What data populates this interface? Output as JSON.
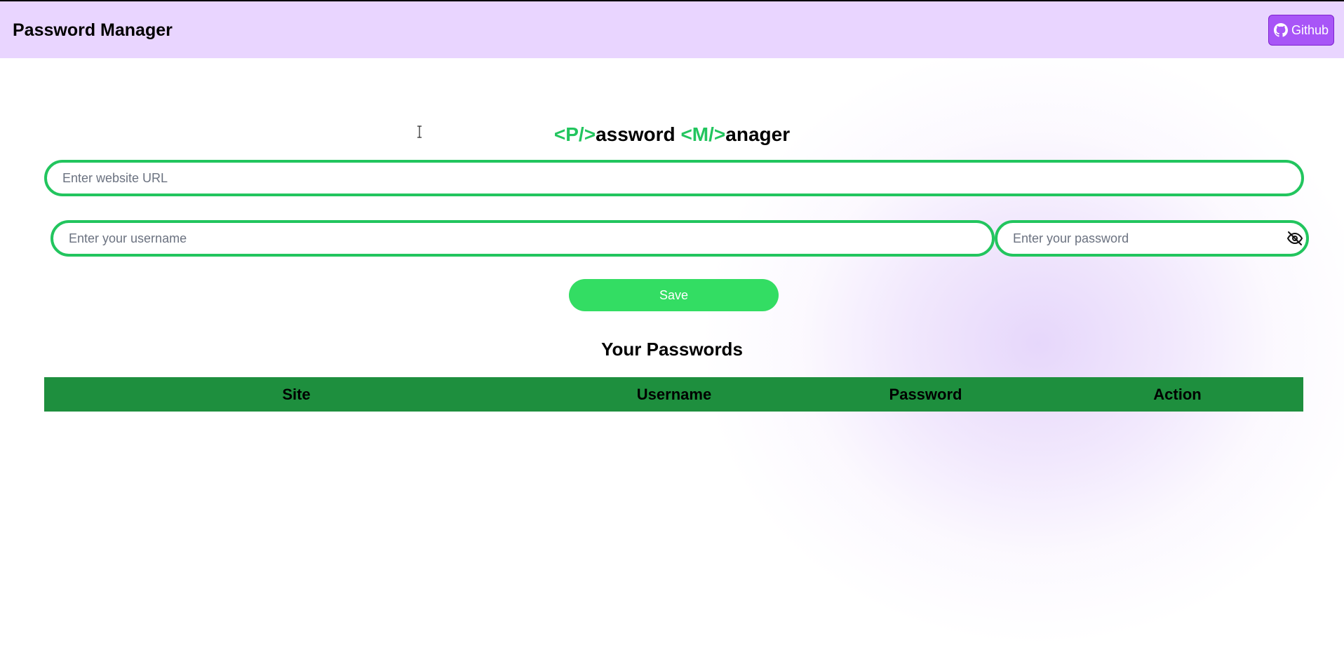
{
  "navbar": {
    "brand": "Password Manager",
    "github_label": "Github"
  },
  "title": {
    "p_tag": "<P/>",
    "p_rest": "assword",
    "m_tag": "<M/>",
    "m_rest": "anager"
  },
  "form": {
    "url_placeholder": "Enter website URL",
    "url_value": "",
    "username_placeholder": "Enter your username",
    "username_value": "",
    "password_placeholder": "Enter your password",
    "password_value": "",
    "save_label": "Save"
  },
  "table": {
    "heading": "Your Passwords",
    "columns": [
      "Site",
      "Username",
      "Password",
      "Action"
    ],
    "rows": []
  },
  "colors": {
    "accent_green": "#22c55e",
    "header_purple": "#e9d5ff",
    "github_purple": "#a855f7",
    "table_header_green": "#1e8f3e",
    "save_green": "#33dd63"
  },
  "icons": {
    "github": "github-icon",
    "password_visibility": "eye-slash-icon"
  }
}
